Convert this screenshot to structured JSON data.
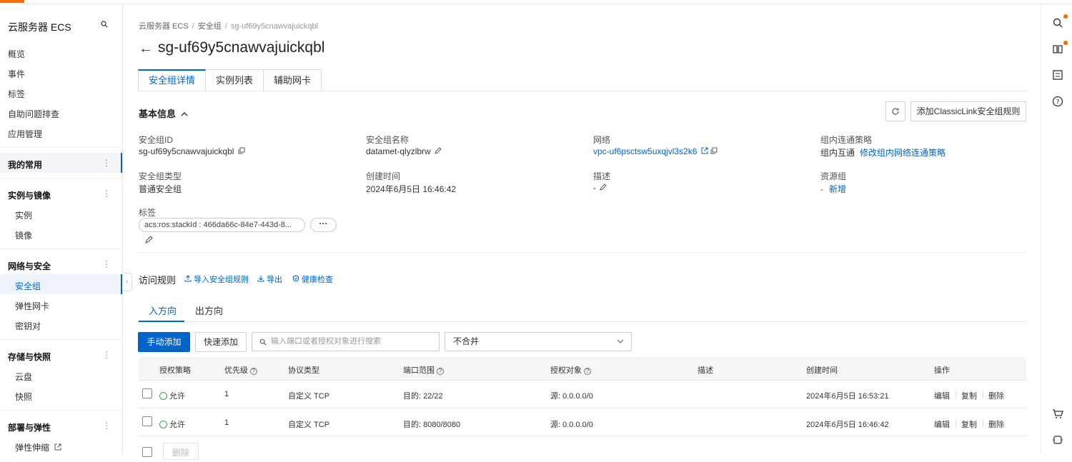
{
  "sidebar": {
    "title": "云服务器 ECS",
    "items": [
      "概览",
      "事件",
      "标签",
      "自助问题排查",
      "应用管理"
    ],
    "favorites": "我的常用",
    "groups": [
      {
        "label": "实例与镜像",
        "children": [
          "实例",
          "镜像"
        ]
      },
      {
        "label": "网络与安全",
        "children": [
          "安全组",
          "弹性网卡",
          "密钥对"
        ]
      },
      {
        "label": "存储与快照",
        "children": [
          "云盘",
          "快照"
        ]
      },
      {
        "label": "部署与弹性",
        "children": [
          "弹性伸缩"
        ]
      }
    ]
  },
  "breadcrumb": [
    "云服务器 ECS",
    "安全组",
    "sg-uf69y5cnawvajuickqbl"
  ],
  "page_title": "sg-uf69y5cnawvajuickqbl",
  "tabs": [
    "安全组详情",
    "实例列表",
    "辅助网卡"
  ],
  "basic_info": {
    "title": "基本信息",
    "add_classiclink_button": "添加ClassicLink安全组规则",
    "fields": {
      "sg_id_label": "安全组ID",
      "sg_id": "sg-uf69y5cnawvajuickqbl",
      "sg_name_label": "安全组名称",
      "sg_name": "datamet-qlyzlbrw",
      "network_label": "网络",
      "network": "vpc-uf6psctsw5uxqjvl3s2k6",
      "intra_policy_label": "组内连通策略",
      "intra_policy": "组内互通",
      "intra_policy_link": "修改组内网络连通策略",
      "sg_type_label": "安全组类型",
      "sg_type": "普通安全组",
      "created_label": "创建时间",
      "created": "2024年6月5日 16:46:42",
      "desc_label": "描述",
      "desc": "-",
      "rg_label": "资源组",
      "rg_dash": "-",
      "rg_link": "新增",
      "tags_label": "标签",
      "tag_value": "acs:ros:stackId : 466da66c-84e7-443d-8...",
      "tag_more": "···"
    }
  },
  "rules": {
    "title": "访问规则",
    "links": [
      "导入安全组规则",
      "导出",
      "健康检查"
    ],
    "directions": [
      "入方向",
      "出方向"
    ],
    "manual_add": "手动添加",
    "quick_add": "快速添加",
    "search_placeholder": "输入端口或者授权对象进行搜索",
    "merge_select": "不合并",
    "columns": [
      "授权策略",
      "优先级",
      "协议类型",
      "端口范围",
      "授权对象",
      "描述",
      "创建时间",
      "操作"
    ],
    "rows": [
      {
        "policy": "允许",
        "priority": "1",
        "protocol": "自定义 TCP",
        "port": "目的: 22/22",
        "object": "源: 0.0.0.0/0",
        "desc": "",
        "created": "2024年6月5日 16:53:21"
      },
      {
        "policy": "允许",
        "priority": "1",
        "protocol": "自定义 TCP",
        "port": "目的: 8080/8080",
        "object": "源: 0.0.0.0/0",
        "desc": "",
        "created": "2024年6月5日 16:46:42"
      }
    ],
    "actions": [
      "编辑",
      "复制",
      "删除"
    ],
    "bulk_delete": "删除"
  },
  "colors": {
    "accent": "#0064c8",
    "brand_orange": "#ff6a00",
    "success": "#3ea64b"
  }
}
